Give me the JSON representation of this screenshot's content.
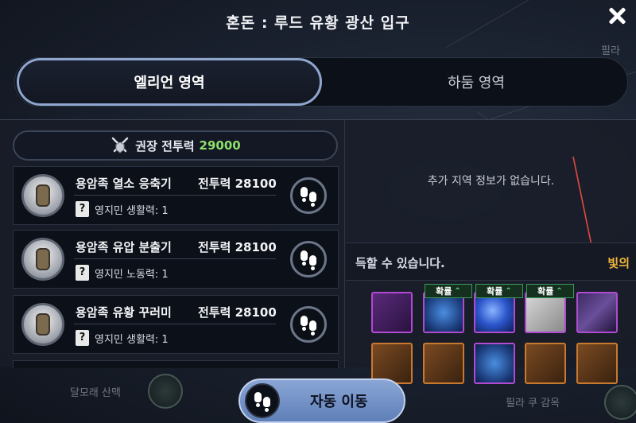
{
  "title": "혼돈 : 루드 유황 광산 입구",
  "tabs": [
    {
      "label": "엘리언 영역",
      "active": true
    },
    {
      "label": "하둠 영역",
      "active": false
    }
  ],
  "recommended": {
    "label": "권장 전투력",
    "value": "29000"
  },
  "monsters": [
    {
      "name": "용암족 열소 응축기",
      "power": "전투력 28100",
      "stat": "영지민 생활력: 1"
    },
    {
      "name": "용암족 유압 분출기",
      "power": "전투력 28100",
      "stat": "영지민 노동력: 1"
    },
    {
      "name": "용암족 유황 꾸러미",
      "power": "전투력 28100",
      "stat": "영지민 생활력: 1"
    }
  ],
  "region_info": "추가 지역 정보가 없습니다.",
  "acquire": {
    "text": "득할 수 있습니다.",
    "accent": "빛의"
  },
  "chip_label": "확률",
  "auto_move_label": "자동 이동",
  "map_labels": {
    "bottom_left": "달모래 산맥",
    "bottom_right": "필라 쿠 감옥",
    "top_right": "필라"
  },
  "colors": {
    "accent_green": "#8fe06a",
    "accent_orange": "#f2b53b",
    "button_blue": "#7f9dd0"
  }
}
